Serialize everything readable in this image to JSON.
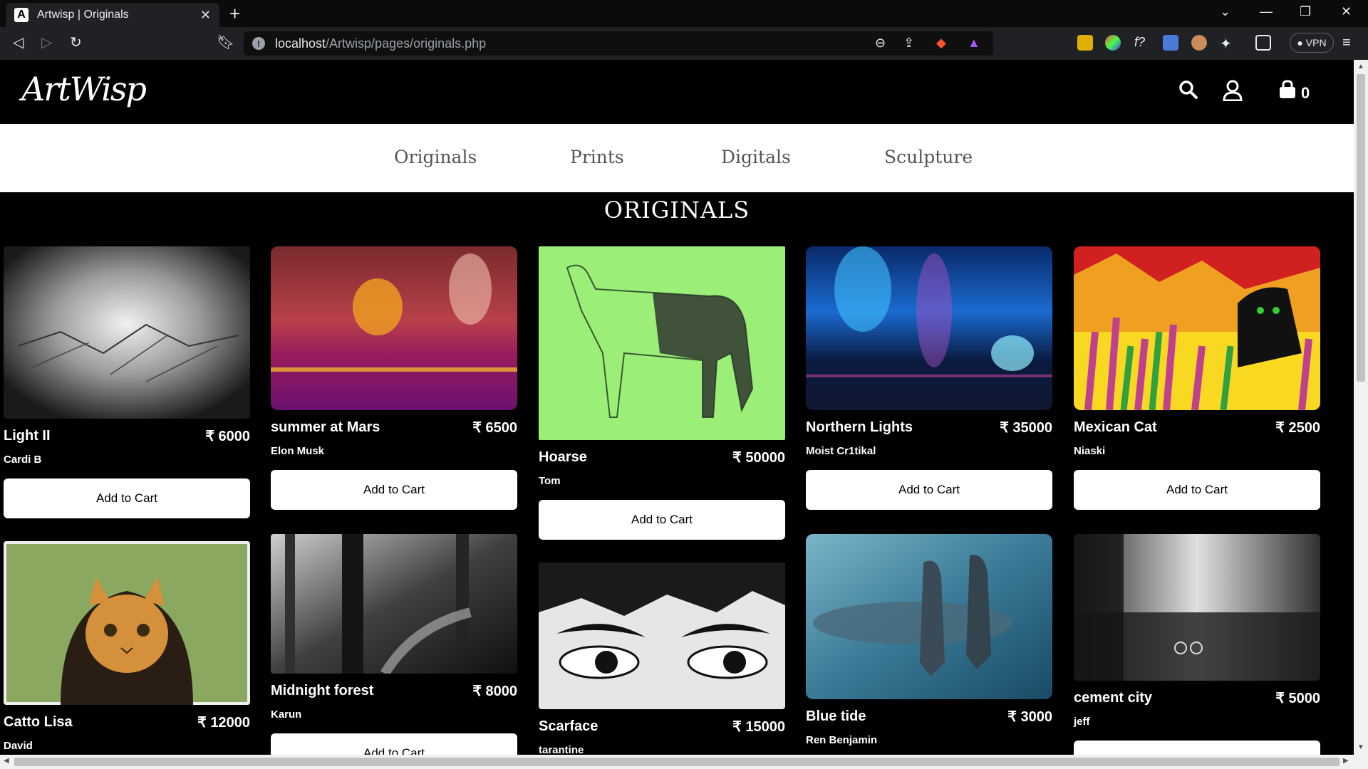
{
  "browser": {
    "tab_title": "Artwisp | Originals",
    "url_host": "localhost",
    "url_path": "/Artwisp/pages/originals.php",
    "vpn_label": "● VPN"
  },
  "site": {
    "logo": "ArtWisp",
    "cart_count": "0",
    "categories": [
      "Originals",
      "Prints",
      "Digitals",
      "Sculpture"
    ],
    "section_title": "ORIGINALS",
    "add_to_cart_label": "Add to Cart"
  },
  "products": [
    {
      "name": "Light II",
      "price": "₹ 6000",
      "artist": "Cardi B"
    },
    {
      "name": "summer at Mars",
      "price": "₹ 6500",
      "artist": "Elon Musk"
    },
    {
      "name": "Hoarse",
      "price": "₹ 50000",
      "artist": "Tom"
    },
    {
      "name": "Northern Lights",
      "price": "₹ 35000",
      "artist": "Moist Cr1tikal"
    },
    {
      "name": "Mexican Cat",
      "price": "₹ 2500",
      "artist": "Niaski"
    },
    {
      "name": "Catto Lisa",
      "price": "₹ 12000",
      "artist": "David"
    },
    {
      "name": "Midnight forest",
      "price": "₹ 8000",
      "artist": "Karun"
    },
    {
      "name": "Scarface",
      "price": "₹ 15000",
      "artist": "tarantine"
    },
    {
      "name": "Blue tide",
      "price": "₹ 3000",
      "artist": "Ren Benjamin"
    },
    {
      "name": "cement city",
      "price": "₹ 5000",
      "artist": "jeff"
    }
  ]
}
